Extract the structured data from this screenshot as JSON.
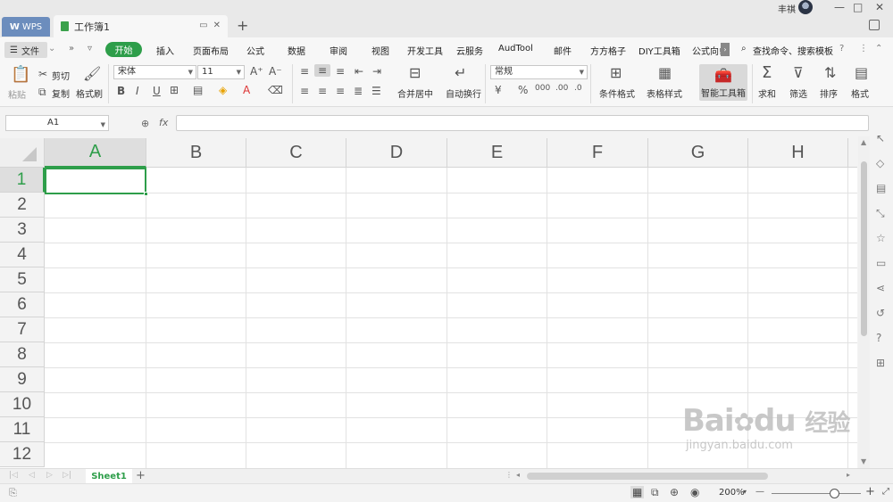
{
  "titlebar": {
    "wps_label": "WPS",
    "doc_tab": "工作簿1",
    "new_tab": "+",
    "user_name": "丰祺",
    "min": "—",
    "max": "□",
    "close": "✕"
  },
  "menu": {
    "file": "文件",
    "start": "开始",
    "items": [
      "插入",
      "页面布局",
      "公式",
      "数据",
      "审阅",
      "视图",
      "开发工具",
      "云服务",
      "AudTool",
      "邮件",
      "方方格子",
      "DIY工具箱",
      "公式向!"
    ],
    "search": "查找命令、搜索模板"
  },
  "ribbon": {
    "paste": "粘贴",
    "cut": "剪切",
    "copy": "复制",
    "format_painter": "格式刷",
    "font_name": "宋体",
    "font_size": "11",
    "bold": "B",
    "italic": "I",
    "underline": "U",
    "merge_center": "合并居中",
    "wrap_text": "自动换行",
    "number_format": "常规",
    "conditional_format": "条件格式",
    "table_style": "表格样式",
    "smart_toolbox": "智能工具箱",
    "sum": "求和",
    "filter": "筛选",
    "sort": "排序",
    "format": "格式",
    "percent": "%"
  },
  "formula": {
    "cell_ref": "A1",
    "fx": "fx",
    "value": ""
  },
  "grid": {
    "columns": [
      "A",
      "B",
      "C",
      "D",
      "E",
      "F",
      "G",
      "H"
    ],
    "rows": [
      "1",
      "2",
      "3",
      "4",
      "5",
      "6",
      "7",
      "8",
      "9",
      "10",
      "11",
      "12"
    ],
    "active_col": "A",
    "active_row": "1"
  },
  "sheets": {
    "tabs": [
      "Sheet1"
    ],
    "add": "+"
  },
  "status": {
    "zoom": "200%",
    "zoom_minus": "—",
    "zoom_plus": "+"
  },
  "watermark": {
    "brand": "Bai",
    "brand2": "du",
    "cn": "经验",
    "url": "jingyan.baidu.com"
  },
  "colors": {
    "accent": "#2e9e4a",
    "wps_tab": "#6c8dbd"
  }
}
